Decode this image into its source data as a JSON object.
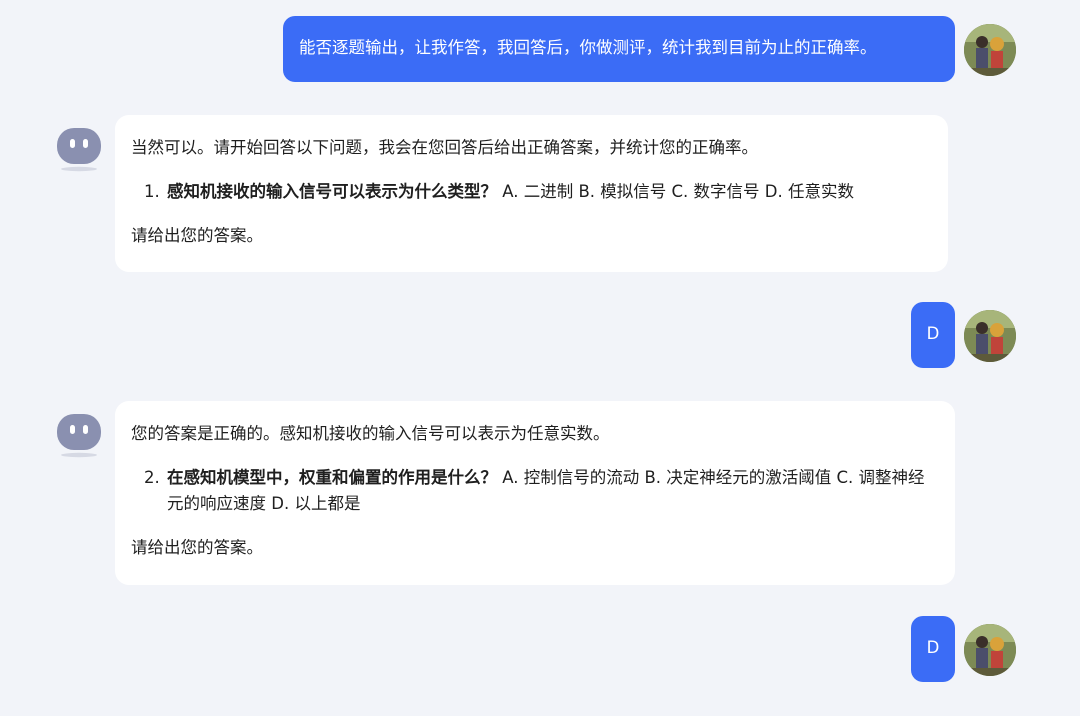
{
  "colors": {
    "background": "#f2f4f9",
    "user_bubble": "#3b6cf6",
    "bot_bubble": "#ffffff",
    "bot_icon": "#8a90b0"
  },
  "messages": {
    "m1": {
      "text": "能否逐题输出，让我作答，我回答后，你做测评，统计我到目前为止的正确率。"
    },
    "m2": {
      "intro": "当然可以。请开始回答以下问题，我会在您回答后给出正确答案，并统计您的正确率。",
      "q_num": "1.",
      "q_bold": "感知机接收的输入信号可以表示为什么类型？",
      "q_options": " A. 二进制 B. 模拟信号 C. 数字信号 D. 任意实数",
      "outro": "请给出您的答案。"
    },
    "m3": {
      "text": "D"
    },
    "m4": {
      "intro": "您的答案是正确的。感知机接收的输入信号可以表示为任意实数。",
      "q_num": "2.",
      "q_bold": "在感知机模型中，权重和偏置的作用是什么？",
      "q_options": " A. 控制信号的流动 B. 决定神经元的激活阈值 C. 调整神经元的响应速度 D. 以上都是",
      "outro": "请给出您的答案。"
    },
    "m5": {
      "text": "D"
    }
  },
  "icons": {
    "bot": "robot-face-icon",
    "user": "user-avatar-photo"
  }
}
